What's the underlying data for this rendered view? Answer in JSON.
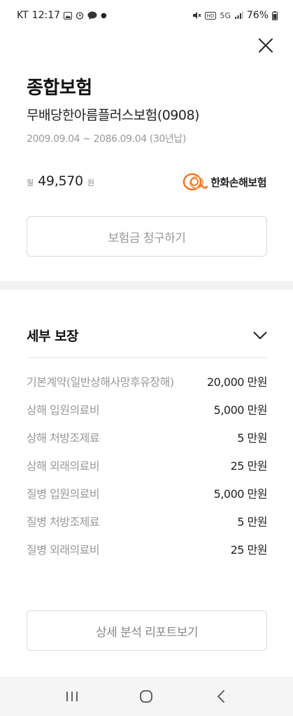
{
  "status_bar": {
    "carrier": "KT",
    "time": "12:17",
    "network": "5G",
    "battery": "76%"
  },
  "header": {
    "close_icon": "close-icon"
  },
  "policy": {
    "category": "종합보험",
    "product_name": "무배당한아름플러스보험(0908)",
    "period": "2009.09.04 ~ 2086.09.04 (30년납)",
    "premium_prefix": "월",
    "premium_amount": "49,570",
    "premium_suffix": "원",
    "insurer_name": "한화손해보험",
    "insurer_logo_color": "#f37321"
  },
  "actions": {
    "claim_label": "보험금 청구하기",
    "report_label": "상세 분석 리포트보기"
  },
  "detail": {
    "title": "세부 보장",
    "items": [
      {
        "name": "기본계약(일반상해사망후유장해)",
        "value": "20,000 만원"
      },
      {
        "name": "상해 입원의료비",
        "value": "5,000 만원"
      },
      {
        "name": "상해 처방조제료",
        "value": "5 만원"
      },
      {
        "name": "상해 외래의료비",
        "value": "25 만원"
      },
      {
        "name": "질병 입원의료비",
        "value": "5,000 만원"
      },
      {
        "name": "질병 처방조제료",
        "value": "5 만원"
      },
      {
        "name": "질병 외래의료비",
        "value": "25 만원"
      }
    ]
  },
  "nav": {
    "recent_icon": "recent-apps-icon",
    "home_icon": "home-icon",
    "back_icon": "back-icon"
  }
}
